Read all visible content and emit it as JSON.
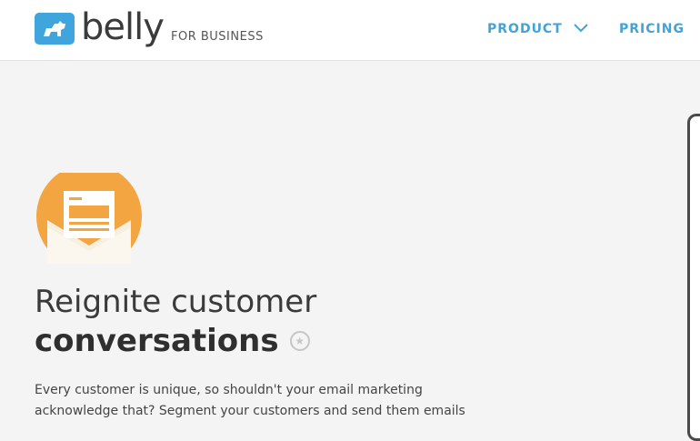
{
  "header": {
    "logo_text": "belly",
    "logo_sub": "FOR BUSINESS",
    "nav": {
      "product": "PRODUCT",
      "pricing": "PRICING"
    }
  },
  "hero": {
    "icon": "envelope-icon",
    "title_line1": "Reignite customer",
    "title_line2": "conversations",
    "badge_icon": "star-icon",
    "body_line1": "Every customer is unique, so shouldn't your email marketing",
    "body_line2": "acknowledge that? Segment your customers and send them emails"
  },
  "colors": {
    "brand_blue": "#3fa5dc",
    "accent_orange": "#f2a541",
    "background": "#f4f4f4"
  }
}
